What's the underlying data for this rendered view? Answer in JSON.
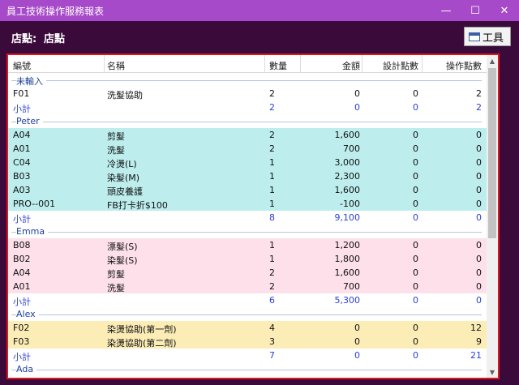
{
  "window": {
    "title": "員工技術操作服務報表",
    "minimize_glyph": "—",
    "maximize_glyph": "☐",
    "close_glyph": "✕"
  },
  "header": {
    "store_label": "店點:",
    "store_value": "店點",
    "tool_button_label": "工具"
  },
  "table": {
    "columns": [
      "編號",
      "名稱",
      "數量",
      "金額",
      "設計點數",
      "操作點數"
    ],
    "sections": [
      {
        "group": "未輸入",
        "theme": "plain",
        "rows": [
          {
            "code": "F01",
            "name": "洗髮協助",
            "qty": "2",
            "amount": "0",
            "design": "0",
            "op": "2"
          }
        ],
        "subtotal": {
          "label": "小計",
          "qty": "2",
          "amount": "0",
          "design": "0",
          "op": "2"
        }
      },
      {
        "group": "Peter",
        "theme": "peter",
        "rows": [
          {
            "code": "A04",
            "name": "剪髮",
            "qty": "2",
            "amount": "1,600",
            "design": "0",
            "op": "0"
          },
          {
            "code": "A01",
            "name": "洗髮",
            "qty": "2",
            "amount": "700",
            "design": "0",
            "op": "0"
          },
          {
            "code": "C04",
            "name": "冷燙(L)",
            "qty": "1",
            "amount": "3,000",
            "design": "0",
            "op": "0"
          },
          {
            "code": "B03",
            "name": "染髮(M)",
            "qty": "1",
            "amount": "2,300",
            "design": "0",
            "op": "0"
          },
          {
            "code": "A03",
            "name": "頭皮養護",
            "qty": "1",
            "amount": "1,600",
            "design": "0",
            "op": "0"
          },
          {
            "code": "PRO--001",
            "name": "FB打卡折$100",
            "qty": "1",
            "amount": "-100",
            "design": "0",
            "op": "0"
          }
        ],
        "subtotal": {
          "label": "小計",
          "qty": "8",
          "amount": "9,100",
          "design": "0",
          "op": "0"
        }
      },
      {
        "group": "Emma",
        "theme": "emma",
        "rows": [
          {
            "code": "B08",
            "name": "漂髮(S)",
            "qty": "1",
            "amount": "1,200",
            "design": "0",
            "op": "0"
          },
          {
            "code": "B02",
            "name": "染髮(S)",
            "qty": "1",
            "amount": "1,800",
            "design": "0",
            "op": "0"
          },
          {
            "code": "A04",
            "name": "剪髮",
            "qty": "2",
            "amount": "1,600",
            "design": "0",
            "op": "0"
          },
          {
            "code": "A01",
            "name": "洗髮",
            "qty": "2",
            "amount": "700",
            "design": "0",
            "op": "0"
          }
        ],
        "subtotal": {
          "label": "小計",
          "qty": "6",
          "amount": "5,300",
          "design": "0",
          "op": "0"
        }
      },
      {
        "group": "Alex",
        "theme": "alex",
        "rows": [
          {
            "code": "F02",
            "name": "染燙協助(第一劑)",
            "qty": "4",
            "amount": "0",
            "design": "0",
            "op": "12"
          },
          {
            "code": "F03",
            "name": "染燙協助(第二劑)",
            "qty": "3",
            "amount": "0",
            "design": "0",
            "op": "9"
          }
        ],
        "subtotal": {
          "label": "小計",
          "qty": "7",
          "amount": "0",
          "design": "0",
          "op": "21"
        }
      },
      {
        "group": "Ada",
        "theme": "plain",
        "rows": [],
        "subtotal": null
      }
    ]
  },
  "colors": {
    "titlebar": "#a64ac9",
    "header_bg": "#3a0a3a",
    "panel_border": "#e0151f",
    "subtotal_text": "#2b3fd6",
    "peter_row": "#bdeeed",
    "emma_row": "#fde0ea",
    "alex_row": "#fcedb6"
  }
}
